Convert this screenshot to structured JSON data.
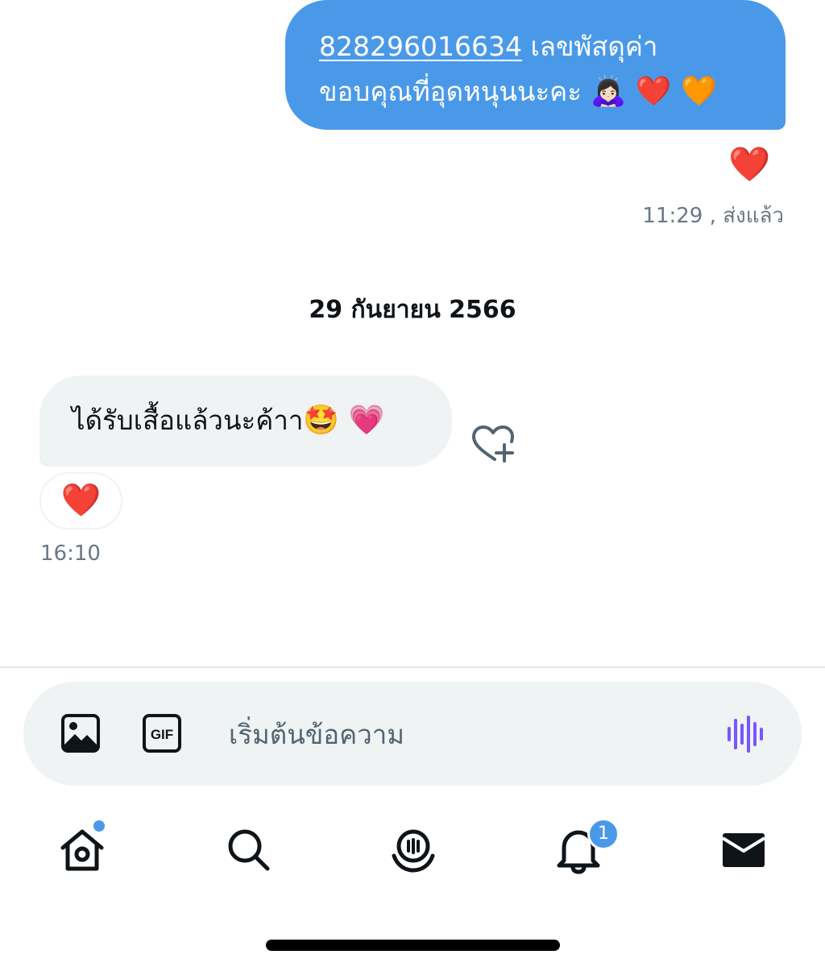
{
  "conversation": {
    "sent_message": {
      "tracking_number": "828296016634",
      "line1_rest": " เลขพัสดุค่า",
      "line2_text": "ขอบคุณที่อุดหนุนนะคะ ",
      "line2_emojis": "🙇🏻‍♀️ ❤️ 🧡",
      "reaction": "❤️",
      "meta": "11:29 , ส่งแล้ว"
    },
    "date_separator": "29 กันยายน 2566",
    "received_message": {
      "text": "ได้รับเสื้อแล้วนะค้าา",
      "emojis": "🤩 💗",
      "reaction": "❤️",
      "time": "16:10"
    }
  },
  "composer": {
    "placeholder": "เริ่มต้นข้อความ",
    "value": "",
    "gif_label": "GIF"
  },
  "nav": {
    "notifications_badge": "1",
    "items": [
      "home-icon",
      "search-icon",
      "spaces-icon",
      "bell-icon",
      "mail-icon"
    ]
  },
  "colors": {
    "accent": "#4a99e9",
    "bubble_received": "#eff3f4",
    "meta_text": "#6b7785",
    "voice_icon": "#7856ff"
  }
}
